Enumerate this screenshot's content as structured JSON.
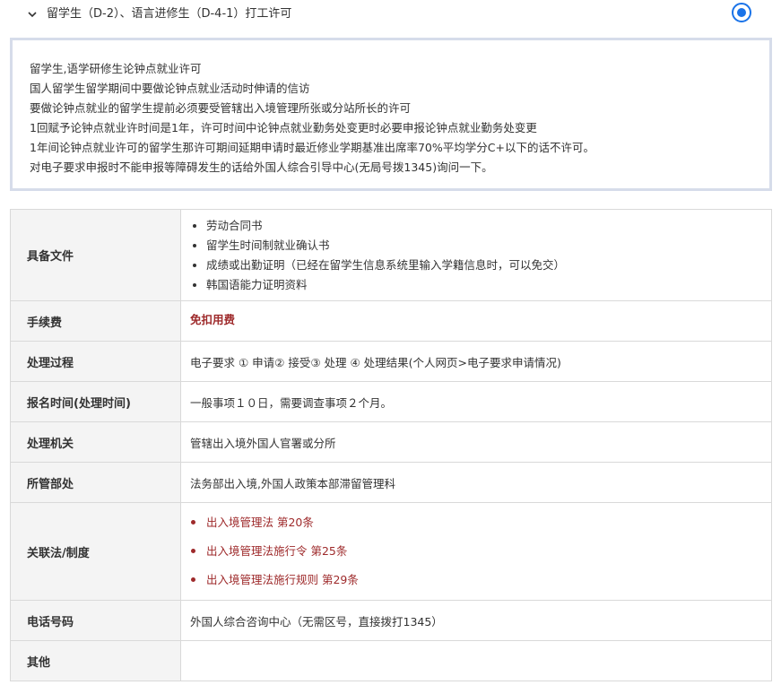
{
  "section": {
    "title": "留学生（D-2）、语言进修生（D-4-1）打工许可",
    "selected": true
  },
  "notice": {
    "lines": [
      "留学生,语学研修生论钟点就业许可",
      "国人留学生留学期间中要做论钟点就业活动时伸请的信访",
      "要做论钟点就业的留学生提前必须要受管辖出入境管理所张或分站所长的许可",
      "1回赋予论钟点就业许时间是1年，许可时间中论钟点就业勤务处变更时必要申报论钟点就业勤务处变更",
      "1年间论钟点就业许可的留学生那许可期间延期申请时最近修业学期基准出席率70%平均学分C+以下的话不许可。",
      "对电子要求申报时不能申报等障碍发生的话给外国人综合引导中心(无局号拨1345)询问一下。"
    ]
  },
  "table": {
    "documents": {
      "label": "具备文件",
      "items": [
        "劳动合同书",
        "留学生时间制就业确认书",
        "成绩或出勤证明（已经在留学生信息系统里输入学籍信息时，可以免交）",
        "韩国语能力证明资料"
      ]
    },
    "fee": {
      "label": "手续费",
      "value": "免扣用费"
    },
    "process": {
      "label": "处理过程",
      "value": "电子要求 ① 申请② 接受③ 处理 ④ 处理结果(个人网页>电子要求申请情况)"
    },
    "time": {
      "label": "报名时间(处理时间)",
      "value": "一般事项１０日，需要调查事项２个月。"
    },
    "agency": {
      "label": "处理机关",
      "value": "管辖出入境外国人官署或分所"
    },
    "department": {
      "label": "所管部处",
      "value": "法务部出入境,外国人政策本部滞留管理科"
    },
    "laws": {
      "label": "关联法/制度",
      "items": [
        "出入境管理法 第20条",
        "出入境管理法施行令 第25条",
        "出入境管理法施行规则 第29条"
      ]
    },
    "phone": {
      "label": "电话号码",
      "value": "外国人综合咨询中心（无需区号，直接拨打1345）"
    },
    "other": {
      "label": "其他",
      "value": ""
    }
  },
  "colors": {
    "accent": "#1a73e8",
    "link": "#9e2a2b",
    "notice_border": "#d6dcea",
    "header_cell_bg": "#f4f4f4"
  },
  "icons": {
    "expand": "chevron-down-icon",
    "select": "radio-selected"
  }
}
